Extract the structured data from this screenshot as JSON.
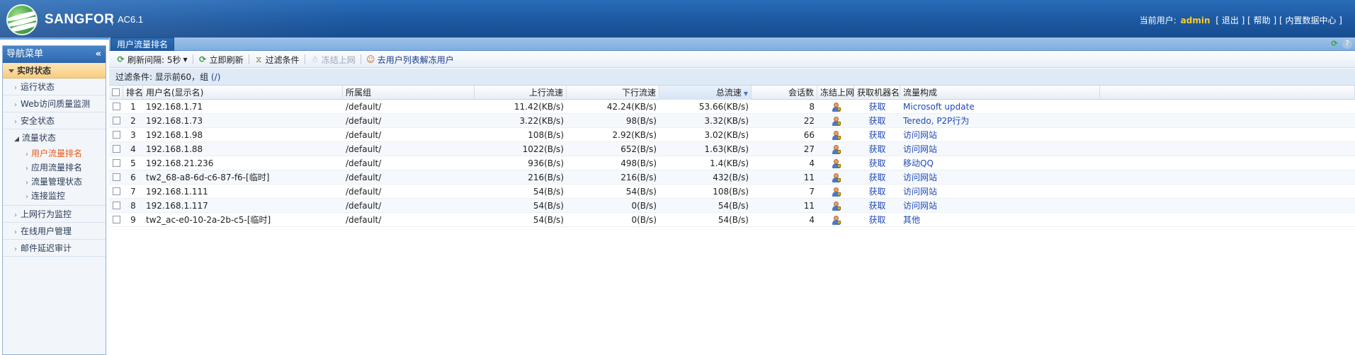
{
  "header": {
    "brand": "SANGFOR",
    "version": "AC6.1",
    "current_user_label": "当前用户:",
    "username": "admin",
    "links": [
      "[ 退出 ]",
      "[ 帮助 ]",
      "[ 内置数据中心 ]"
    ]
  },
  "sidebar": {
    "title": "导航菜单",
    "collapse_glyph": "«",
    "section": "实时状态",
    "items_top": [
      "运行状态",
      "Web访问质量监测",
      "安全状态"
    ],
    "group_title": "流量状态",
    "group_items": [
      "用户流量排名",
      "应用流量排名",
      "流量管理状态",
      "连接监控"
    ],
    "active_item": "用户流量排名",
    "items_bottom": [
      "上网行为监控",
      "在线用户管理",
      "邮件延迟审计"
    ]
  },
  "tab": {
    "label": "用户流量排名"
  },
  "toolbar": {
    "refresh_interval": "刷新间隔: 5秒",
    "refresh_now": "立即刷新",
    "filter": "过滤条件",
    "freeze": "冻结上网",
    "unfreeze": "去用户列表解冻用户"
  },
  "filter_bar": {
    "text": "过滤条件: 显示前60，组",
    "link": "(/)"
  },
  "table": {
    "columns": {
      "rank": "排名",
      "user": "用户名(显示名)",
      "group": "所属组",
      "up": "上行流速",
      "down": "下行流速",
      "total": "总流速",
      "sessions": "会话数",
      "freeze": "冻结上网",
      "fetch": "获取机器名",
      "composition": "流量构成"
    },
    "sorted_column": "total",
    "rows": [
      {
        "rank": "1",
        "user": "192.168.1.71",
        "group": "/default/",
        "up": "11.42(KB/s)",
        "down": "42.24(KB/s)",
        "total": "53.66(KB/s)",
        "sessions": "8",
        "fetch": "获取",
        "composition": "Microsoft update"
      },
      {
        "rank": "2",
        "user": "192.168.1.73",
        "group": "/default/",
        "up": "3.22(KB/s)",
        "down": "98(B/s)",
        "total": "3.32(KB/s)",
        "sessions": "22",
        "fetch": "获取",
        "composition": "Teredo, P2P行为"
      },
      {
        "rank": "3",
        "user": "192.168.1.98",
        "group": "/default/",
        "up": "108(B/s)",
        "down": "2.92(KB/s)",
        "total": "3.02(KB/s)",
        "sessions": "66",
        "fetch": "获取",
        "composition": "访问网站"
      },
      {
        "rank": "4",
        "user": "192.168.1.88",
        "group": "/default/",
        "up": "1022(B/s)",
        "down": "652(B/s)",
        "total": "1.63(KB/s)",
        "sessions": "27",
        "fetch": "获取",
        "composition": "访问网站"
      },
      {
        "rank": "5",
        "user": "192.168.21.236",
        "group": "/default/",
        "up": "936(B/s)",
        "down": "498(B/s)",
        "total": "1.4(KB/s)",
        "sessions": "4",
        "fetch": "获取",
        "composition": "移动QQ"
      },
      {
        "rank": "6",
        "user": "tw2_68-a8-6d-c6-87-f6-[临时]",
        "group": "/default/",
        "up": "216(B/s)",
        "down": "216(B/s)",
        "total": "432(B/s)",
        "sessions": "11",
        "fetch": "获取",
        "composition": "访问网站"
      },
      {
        "rank": "7",
        "user": "192.168.1.111",
        "group": "/default/",
        "up": "54(B/s)",
        "down": "54(B/s)",
        "total": "108(B/s)",
        "sessions": "7",
        "fetch": "获取",
        "composition": "访问网站"
      },
      {
        "rank": "8",
        "user": "192.168.1.117",
        "group": "/default/",
        "up": "54(B/s)",
        "down": "0(B/s)",
        "total": "54(B/s)",
        "sessions": "11",
        "fetch": "获取",
        "composition": "访问网站"
      },
      {
        "rank": "9",
        "user": "tw2_ac-e0-10-2a-2b-c5-[临时]",
        "group": "/default/",
        "up": "54(B/s)",
        "down": "0(B/s)",
        "total": "54(B/s)",
        "sessions": "4",
        "fetch": "获取",
        "composition": "其他"
      }
    ]
  }
}
